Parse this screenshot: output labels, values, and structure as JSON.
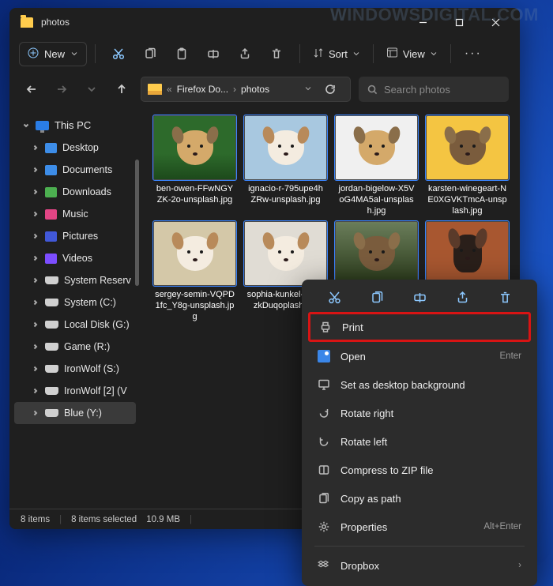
{
  "titlebar": {
    "title": "photos"
  },
  "toolbar": {
    "new_label": "New",
    "sort_label": "Sort",
    "view_label": "View"
  },
  "breadcrumb": {
    "parent": "Firefox Do...",
    "current": "photos"
  },
  "search": {
    "placeholder": "Search photos"
  },
  "sidebar": {
    "root": "This PC",
    "items": [
      "Desktop",
      "Documents",
      "Downloads",
      "Music",
      "Pictures",
      "Videos",
      "System Reserv",
      "System (C:)",
      "Local Disk (G:)",
      "Game (R:)",
      "IronWolf (S:)",
      "IronWolf [2] (V",
      "Blue (Y:)"
    ]
  },
  "files": [
    "ben-owen-FFwNGYZK-2o-unsplash.jpg",
    "ignacio-r-795upe4hZRw-unsplash.jpg",
    "jordan-bigelow-X5VoG4MA5aI-unsplash.jpg",
    "karsten-winegeart-NE0XGVKTmcA-unsplash.jpg",
    "sergey-semin-VQPD1fc_Y8g-unsplash.jpg",
    "sophia-kunkel-2U50zkDuqoplash.jpg"
  ],
  "status": {
    "count": "8 items",
    "selected": "8 items selected",
    "size": "10.9 MB"
  },
  "context_menu": {
    "items": {
      "print": "Print",
      "open": "Open",
      "open_shortcut": "Enter",
      "background": "Set as desktop background",
      "rotate_right": "Rotate right",
      "rotate_left": "Rotate left",
      "compress": "Compress to ZIP file",
      "copy_path": "Copy as path",
      "properties": "Properties",
      "properties_shortcut": "Alt+Enter",
      "dropbox": "Dropbox"
    }
  },
  "watermark": {
    "a": "W",
    "b": "INDOWS",
    "c": "D",
    "d": "IGITAL",
    "e": ".COM"
  }
}
